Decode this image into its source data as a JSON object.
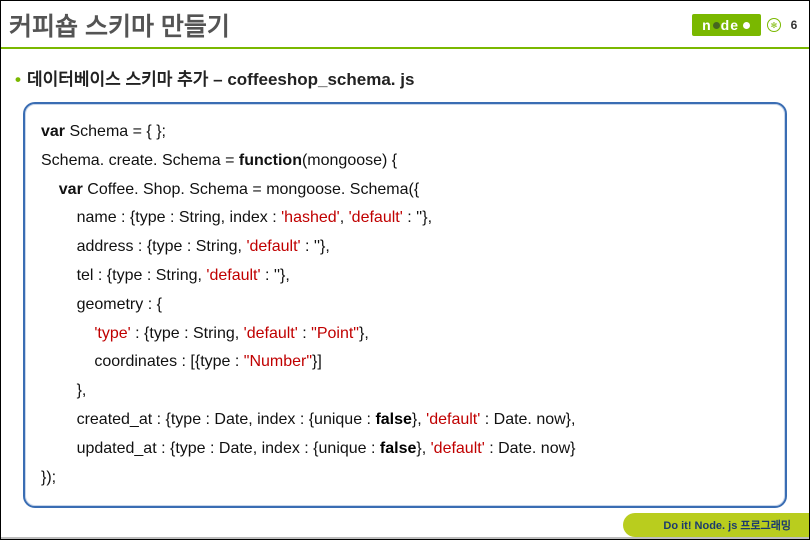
{
  "header": {
    "title": "커피숍 스키마 만들기",
    "logo_left": "n",
    "logo_right": "de",
    "page_number": "6"
  },
  "subtitle": "데이터베이스 스키마 추가 – coffeeshop_schema. js",
  "code": {
    "l1_a": "var",
    "l1_b": " Schema = { };",
    "l2_a": "Schema. create. Schema = ",
    "l2_b": "function",
    "l2_c": "(mongoose) {",
    "l3_a": "    var",
    "l3_b": " Coffee. Shop. Schema = mongoose. Schema({",
    "l4_a": "        name : {type : String, index : ",
    "l4_b": "'hashed'",
    "l4_c": ", ",
    "l4_d": "'default'",
    "l4_e": " : ''},",
    "l5_a": "        address : {type : String, ",
    "l5_b": "'default'",
    "l5_c": " : ''},",
    "l6_a": "        tel : {type : String, ",
    "l6_b": "'default'",
    "l6_c": " : ''},",
    "l7": "        geometry : {",
    "l8_a": "            ",
    "l8_b": "'type'",
    "l8_c": " : {type : String, ",
    "l8_d": "'default'",
    "l8_e": " : ",
    "l8_f": "\"Point\"",
    "l8_g": "},",
    "l9_a": "            coordinates : [{type : ",
    "l9_b": "\"Number\"",
    "l9_c": "}]",
    "l10": "        },",
    "l11_a": "        created_at : {type : Date, index : {unique : ",
    "l11_b": "false",
    "l11_c": "}, ",
    "l11_d": "'default'",
    "l11_e": " : Date. now},",
    "l12_a": "        updated_at : {type : Date, index : {unique : ",
    "l12_b": "false",
    "l12_c": "}, ",
    "l12_d": "'default'",
    "l12_e": " : Date. now}",
    "l13": "});"
  },
  "footer": {
    "badge": "Do it! Node. js 프로그래밍"
  }
}
